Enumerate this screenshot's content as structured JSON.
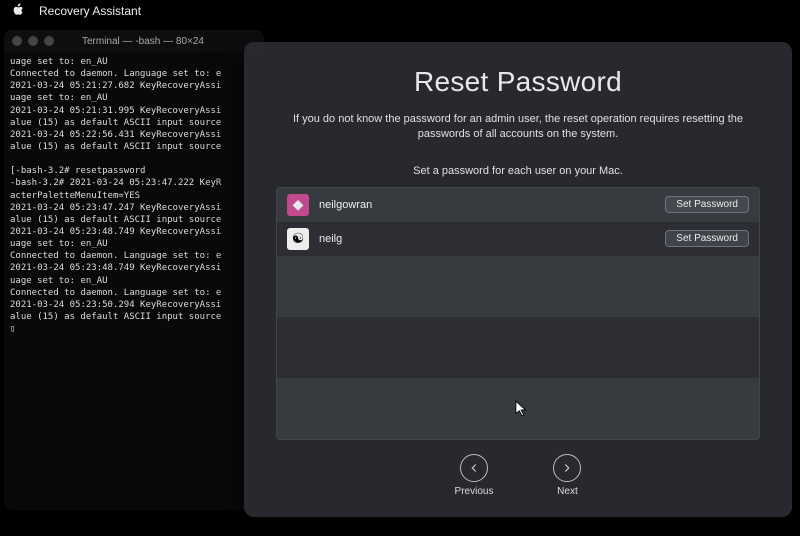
{
  "menubar": {
    "app_name": "Recovery Assistant"
  },
  "terminal": {
    "title": "Terminal — -bash — 80×24",
    "body": "uage set to: en_AU\nConnected to daemon. Language set to: e\n2021-03-24 05:21:27.682 KeyRecoveryAssi\nuage set to: en_AU\n2021-03-24 05:21:31.995 KeyRecoveryAssi\nalue (15) as default ASCII input source\n2021-03-24 05:22:56.431 KeyRecoveryAssi\nalue (15) as default ASCII input source\n\n[-bash-3.2# resetpassword\n-bash-3.2# 2021-03-24 05:23:47.222 KeyR\nacterPaletteMenuItem=YES\n2021-03-24 05:23:47.247 KeyRecoveryAssi\nalue (15) as default ASCII input source\n2021-03-24 05:23:48.749 KeyRecoveryAssi\nuage set to: en_AU\nConnected to daemon. Language set to: e\n2021-03-24 05:23:48.749 KeyRecoveryAssi\nuage set to: en_AU\nConnected to daemon. Language set to: e\n2021-03-24 05:23:50.294 KeyRecoveryAssi\nalue (15) as default ASCII input source\n▯"
  },
  "dialog": {
    "title": "Reset Password",
    "description": "If you do not know the password for an admin user, the reset operation requires resetting the passwords of all accounts on the system.",
    "subtitle": "Set a password for each user on your Mac.",
    "users": [
      {
        "name": "neilgowran",
        "button": "Set Password"
      },
      {
        "name": "neilg",
        "button": "Set Password"
      }
    ],
    "nav": {
      "previous": "Previous",
      "next": "Next"
    }
  }
}
